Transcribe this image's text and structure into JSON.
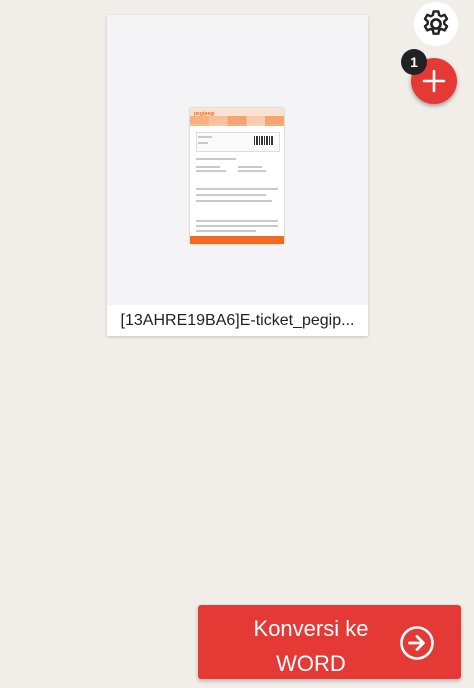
{
  "file": {
    "name": "[13AHRE19BA6]E-ticket_pegip...",
    "thumbnail_logo": "pegipegi"
  },
  "badge": {
    "count": "1"
  },
  "icons": {
    "settings": "gear-icon",
    "add": "plus-icon",
    "convert": "arrow-right-circle-icon"
  },
  "convert_button": {
    "line1": "Konversi ke",
    "line2": "WORD"
  },
  "colors": {
    "background": "#f1eee9",
    "accent": "#e53935",
    "badge": "#222222"
  }
}
